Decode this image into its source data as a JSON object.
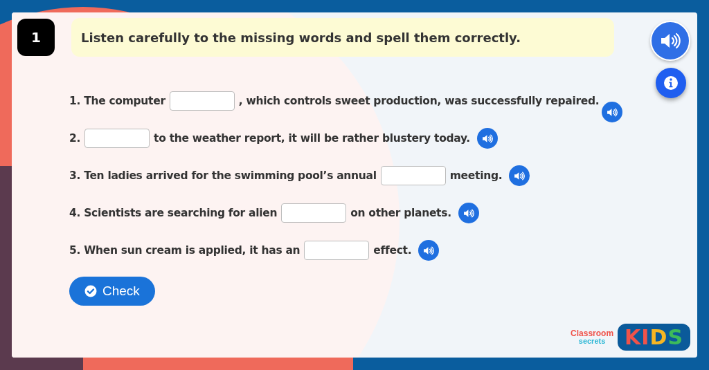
{
  "question": {
    "number": "1",
    "instruction": "Listen carefully to the missing words and spell them correctly."
  },
  "sentences": [
    {
      "before": "1. The computer",
      "after": ", which controls sweet production, was successfully repaired."
    },
    {
      "before": "2.",
      "after": "to the weather report, it will be rather blustery today."
    },
    {
      "before": "3. Ten ladies arrived for the swimming pool’s annual",
      "after": "meeting."
    },
    {
      "before": "4. Scientists are searching for alien",
      "after": "on other planets."
    },
    {
      "before": "5. When sun cream is applied, it has an",
      "after": "effect."
    }
  ],
  "check_button": {
    "label": "Check"
  },
  "logo": {
    "line_1": "Classroom",
    "line_2": "secrets",
    "badge": "KIDS"
  }
}
